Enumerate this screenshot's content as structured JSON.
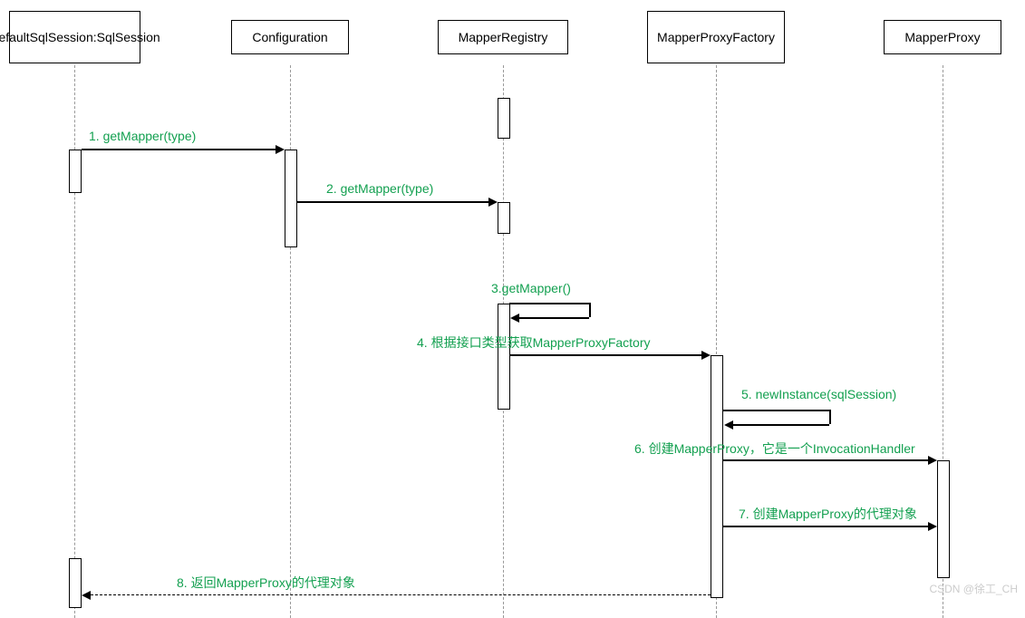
{
  "participants": {
    "p1": "DefaultSqlSession:SqlSession",
    "p2": "Configuration",
    "p3": "MapperRegistry",
    "p4": "MapperProxyFactory",
    "p5": "MapperProxy"
  },
  "messages": {
    "m1": "1. getMapper(type)",
    "m2": "2. getMapper(type)",
    "m3": "3.getMapper()",
    "m4": "4. 根据接口类型获取MapperProxyFactory",
    "m5": "5. newInstance(sqlSession)",
    "m6": "6. 创建MapperProxy，它是一个InvocationHandler",
    "m7": "7. 创建MapperProxy的代理对象",
    "m8": "8. 返回MapperProxy的代理对象"
  },
  "watermark": "CSDN @徐工_CH",
  "chart_data": {
    "type": "sequence-diagram",
    "participants": [
      "DefaultSqlSession:SqlSession",
      "Configuration",
      "MapperRegistry",
      "MapperProxyFactory",
      "MapperProxy"
    ],
    "messages": [
      {
        "seq": 1,
        "from": "DefaultSqlSession:SqlSession",
        "to": "Configuration",
        "label": "getMapper(type)",
        "kind": "sync"
      },
      {
        "seq": 2,
        "from": "Configuration",
        "to": "MapperRegistry",
        "label": "getMapper(type)",
        "kind": "sync"
      },
      {
        "seq": 3,
        "from": "MapperRegistry",
        "to": "MapperRegistry",
        "label": "getMapper()",
        "kind": "self"
      },
      {
        "seq": 4,
        "from": "MapperRegistry",
        "to": "MapperProxyFactory",
        "label": "根据接口类型获取MapperProxyFactory",
        "kind": "sync"
      },
      {
        "seq": 5,
        "from": "MapperProxyFactory",
        "to": "MapperProxyFactory",
        "label": "newInstance(sqlSession)",
        "kind": "self"
      },
      {
        "seq": 6,
        "from": "MapperProxyFactory",
        "to": "MapperProxy",
        "label": "创建MapperProxy，它是一个InvocationHandler",
        "kind": "sync"
      },
      {
        "seq": 7,
        "from": "MapperProxyFactory",
        "to": "MapperProxy",
        "label": "创建MapperProxy的代理对象",
        "kind": "sync"
      },
      {
        "seq": 8,
        "from": "MapperProxyFactory",
        "to": "DefaultSqlSession:SqlSession",
        "label": "返回MapperProxy的代理对象",
        "kind": "return"
      }
    ]
  }
}
